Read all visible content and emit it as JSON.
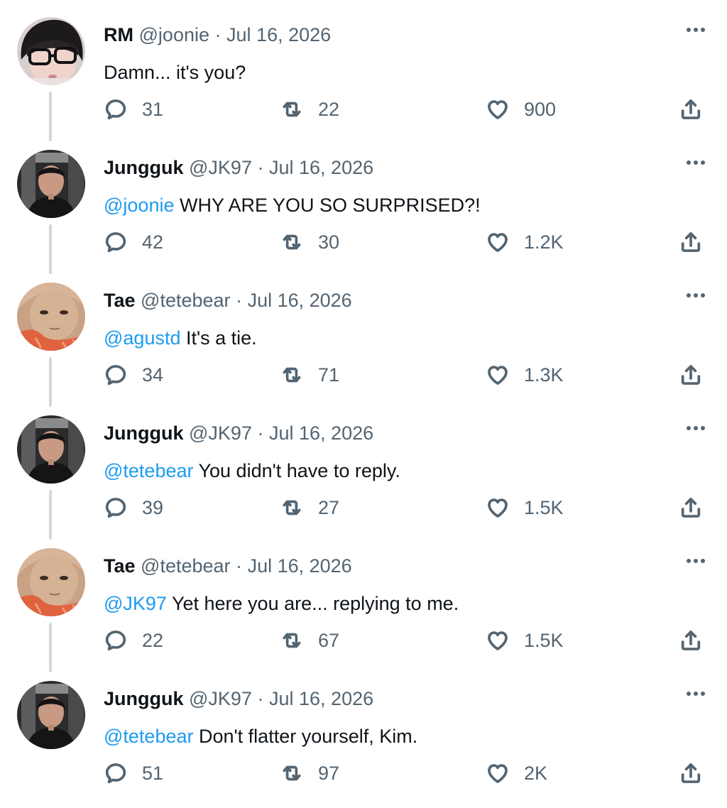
{
  "colors": {
    "text": "#0f1419",
    "secondary": "#536471",
    "mention": "#1d9bf0",
    "thread_line": "#cfd9de"
  },
  "icons": {
    "more": "more-horizontal-icon",
    "reply": "reply-bubble-icon",
    "retweet": "retweet-icon",
    "like": "heart-icon",
    "share": "share-upload-icon"
  },
  "tweets": [
    {
      "name": "RM",
      "handle": "@joonie",
      "sep": "·",
      "date": "Jul 16, 2026",
      "mention": "",
      "text": " Damn... it's you?",
      "replies": "31",
      "retweets": "22",
      "likes": "900"
    },
    {
      "name": "Jungguk",
      "handle": "@JK97",
      "sep": "·",
      "date": "Jul 16, 2026",
      "mention": "@joonie",
      "text": " WHY ARE YOU SO SURPRISED?!",
      "replies": "42",
      "retweets": "30",
      "likes": "1.2K"
    },
    {
      "name": "Tae",
      "handle": "@tetebear",
      "sep": "·",
      "date": "Jul 16, 2026",
      "mention": "@agustd",
      "text": " It's a tie.",
      "replies": "34",
      "retweets": "71",
      "likes": "1.3K"
    },
    {
      "name": "Jungguk",
      "handle": "@JK97",
      "sep": "·",
      "date": "Jul 16, 2026",
      "mention": "@tetebear",
      "text": " You didn't have to reply.",
      "replies": "39",
      "retweets": "27",
      "likes": "1.5K"
    },
    {
      "name": "Tae",
      "handle": "@tetebear",
      "sep": "·",
      "date": "Jul 16, 2026",
      "mention": "@JK97",
      "text": " Yet here you are... replying to me.",
      "replies": "22",
      "retweets": "67",
      "likes": "1.5K"
    },
    {
      "name": "Jungguk",
      "handle": "@JK97",
      "sep": "·",
      "date": "Jul 16, 2026",
      "mention": "@tetebear",
      "text": " Don't flatter yourself, Kim.",
      "replies": "51",
      "retweets": "97",
      "likes": "2K"
    }
  ]
}
